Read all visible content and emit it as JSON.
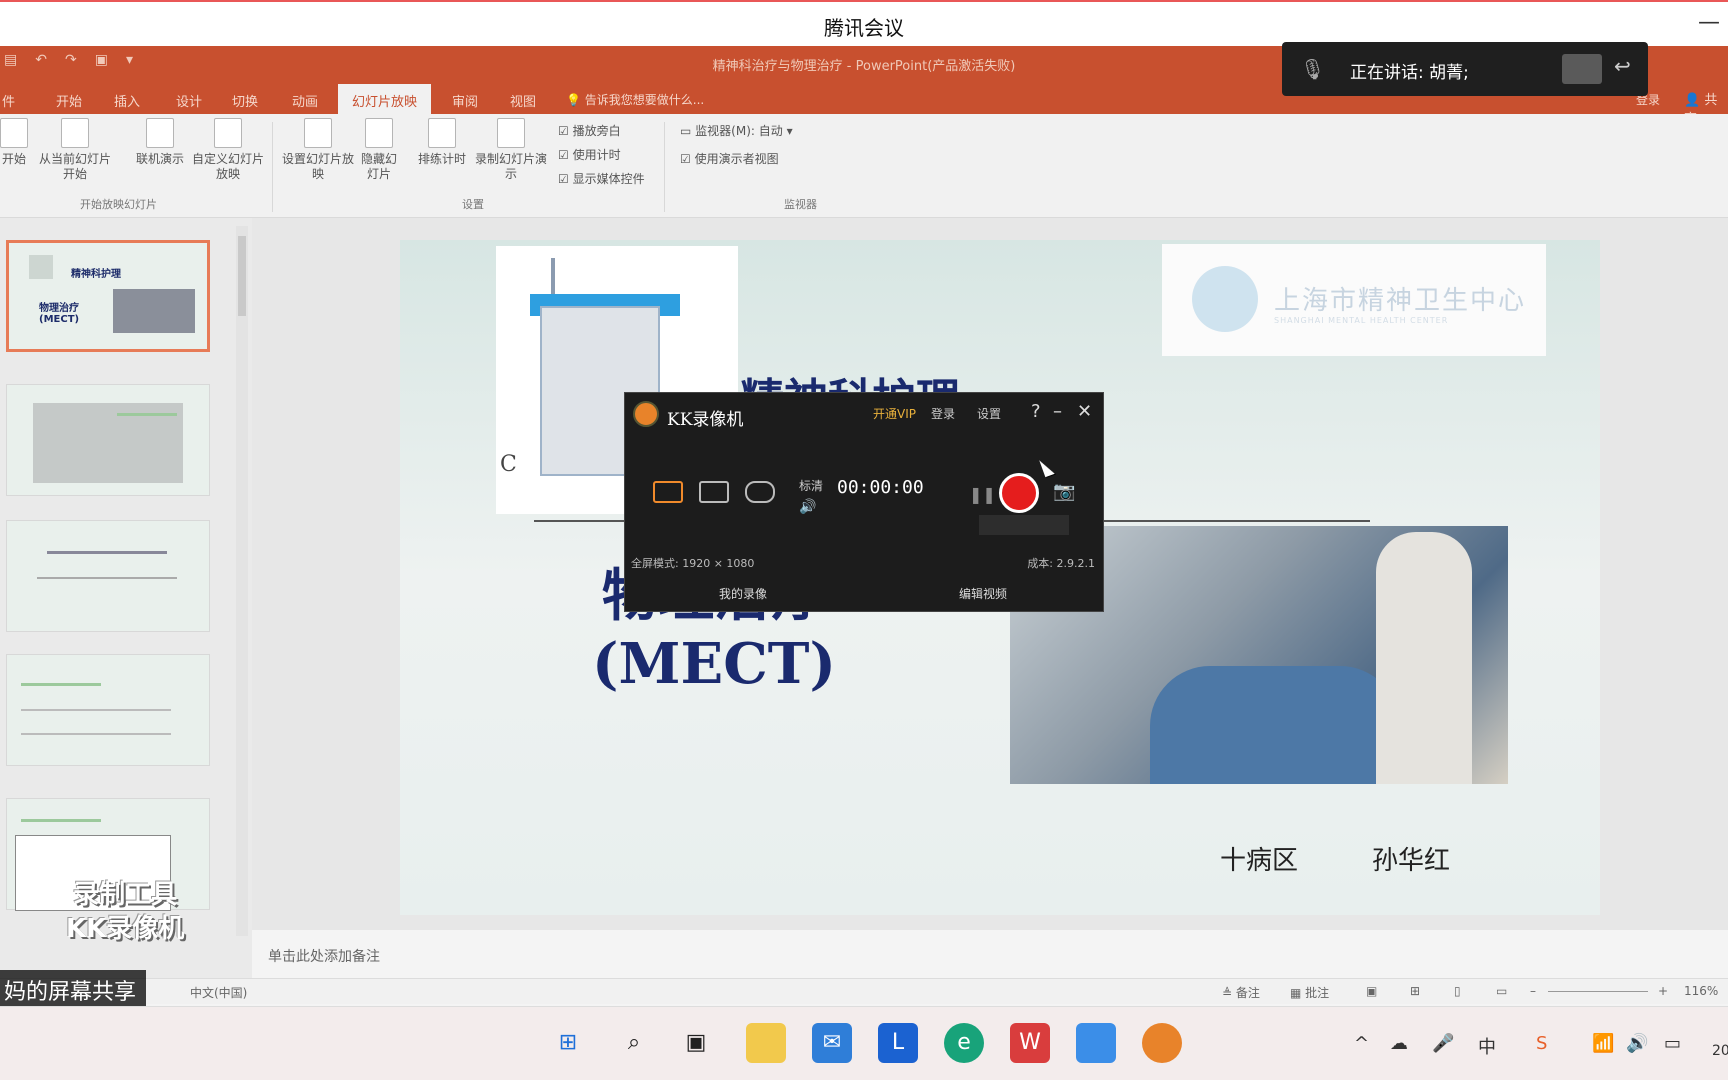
{
  "meeting": {
    "title": "腾讯会议",
    "minimize": "—",
    "speaking": "正在讲话: 胡菁;",
    "share_label": "妈的屏幕共享"
  },
  "ppt": {
    "window_title": "精神科治疗与物理治疗 - PowerPoint(产品激活失败)",
    "tabs": [
      "开始",
      "插入",
      "设计",
      "切换",
      "动画",
      "幻灯片放映",
      "审阅",
      "视图"
    ],
    "active_tab": "幻灯片放映",
    "tellme": "告诉我您想要做什么...",
    "login": "登录",
    "share": "共享",
    "ribbon_buttons": [
      "开始",
      "从当前幻灯片开始",
      "联机演示",
      "自定义幻灯片放映",
      "设置幻灯片放映",
      "隐藏幻灯片",
      "排练计时",
      "录制幻灯片演示"
    ],
    "checkboxes": [
      "播放旁白",
      "使用计时",
      "显示媒体控件",
      "使用演示者视图"
    ],
    "monitor_label": "监视器(M):",
    "monitor_value": "自动",
    "groups": [
      "开始放映幻灯片",
      "设置",
      "监视器"
    ],
    "notes_placeholder": "单击此处添加备注",
    "status": {
      "language": "中文(中国)",
      "notes": "备注",
      "comments": "批注",
      "zoom": "116%"
    }
  },
  "slide": {
    "title_top": "精神科护理",
    "title_main": "物理治疗 (MECT)",
    "equip_letter": "C",
    "logo_cn": "上海市精神卫生中心",
    "logo_en": "SHANGHAI MENTAL HEALTH CENTER",
    "footer_ward": "十病区",
    "footer_name": "孙华红"
  },
  "thumbnails": [
    {
      "title": "精神科护理",
      "subtitle": "物理治疗 (MECT)"
    }
  ],
  "kk": {
    "title": "KK录像机",
    "links": [
      "开通VIP",
      "登录",
      "设置"
    ],
    "quality": "标清",
    "time": "00:00:00",
    "mode_info": "全屏模式: 1920 × 1080",
    "cost": "成本: 2.9.2.1",
    "my_videos": "我的录像",
    "edit_video": "编辑视频",
    "watermark_line1": "录制工具",
    "watermark_line2": "KK录像机"
  },
  "taskbar": {
    "apps": [
      "start-icon",
      "search-icon",
      "task-view-icon",
      "file-explorer-icon",
      "mail-icon",
      "lenovo-icon",
      "edge-icon",
      "wps-icon",
      "photos-icon",
      "kk-recorder-icon"
    ],
    "tray_ime": "中",
    "clock": "20"
  }
}
